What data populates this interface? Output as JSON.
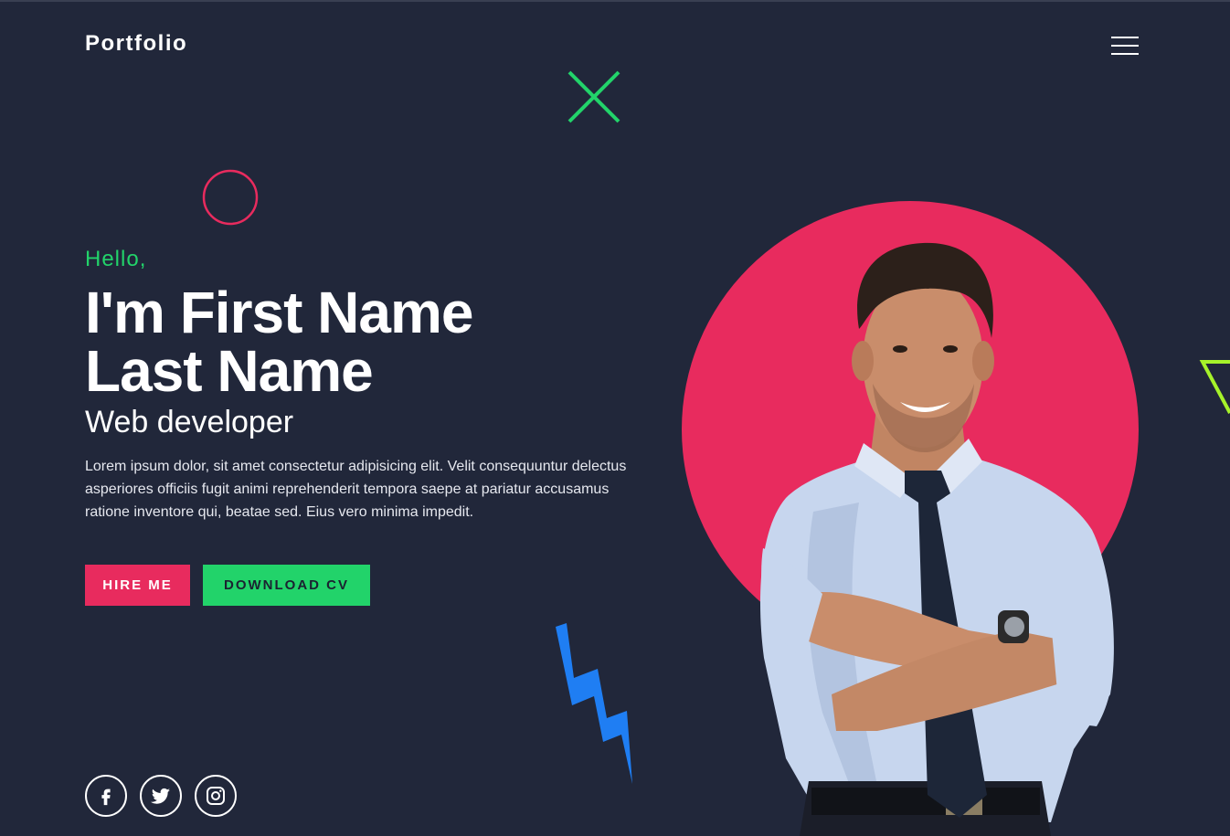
{
  "header": {
    "brand": "Portfolio",
    "menu_icon": "hamburger-menu-icon"
  },
  "hero": {
    "greeting": "Hello,",
    "name_line1": "I'm First Name",
    "name_line2": "Last Name",
    "role": "Web developer",
    "bio": "Lorem ipsum dolor, sit amet consectetur adipisicing elit. Velit consequuntur delectus asperiores officiis fugit animi reprehenderit tempora saepe at pariatur accusamus ratione inventore qui, beatae sed. Eius vero minima impedit.",
    "buttons": {
      "hire": "HIRE ME",
      "cv": "DOWNLOAD CV"
    }
  },
  "social": [
    {
      "icon": "facebook-icon"
    },
    {
      "icon": "twitter-icon"
    },
    {
      "icon": "instagram-icon"
    }
  ],
  "decorations": [
    "x-cross-icon",
    "circle-outline-icon",
    "lightning-bolt-icon",
    "triangle-outline-icon"
  ],
  "colors": {
    "background": "#21273a",
    "accent_pink": "#e82b5e",
    "accent_green": "#22d36a",
    "accent_blue": "#1f7ef3",
    "accent_lime": "#a6f22a",
    "text": "#ffffff"
  }
}
